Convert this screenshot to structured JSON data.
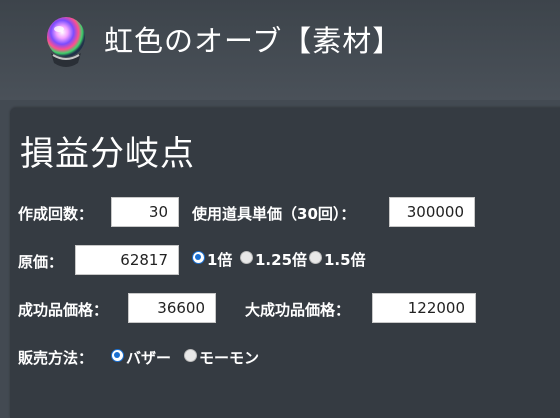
{
  "header": {
    "item_name": "虹色のオーブ【素材】",
    "icon": "rainbow-orb-icon"
  },
  "panel": {
    "title": "損益分岐点",
    "craft_count": {
      "label": "作成回数：",
      "value": "30"
    },
    "tool_unit_price": {
      "label": "使用道具単価（30回）：",
      "value": "300000"
    },
    "cost_price": {
      "label": "原価：",
      "value": "62817"
    },
    "multiplier": {
      "options": [
        "1倍",
        "1.25倍",
        "1.5倍"
      ],
      "selected": "1倍"
    },
    "success_price": {
      "label": "成功品価格：",
      "value": "36600"
    },
    "great_success_price": {
      "label": "大成功品価格：",
      "value": "122000"
    },
    "sale_method": {
      "label": "販売方法：",
      "options": [
        "バザー",
        "モーモン"
      ],
      "selected": "バザー"
    }
  },
  "colors": {
    "background": "#434a52",
    "panel": "#353b42",
    "radio_accent": "#1a6fd1"
  }
}
